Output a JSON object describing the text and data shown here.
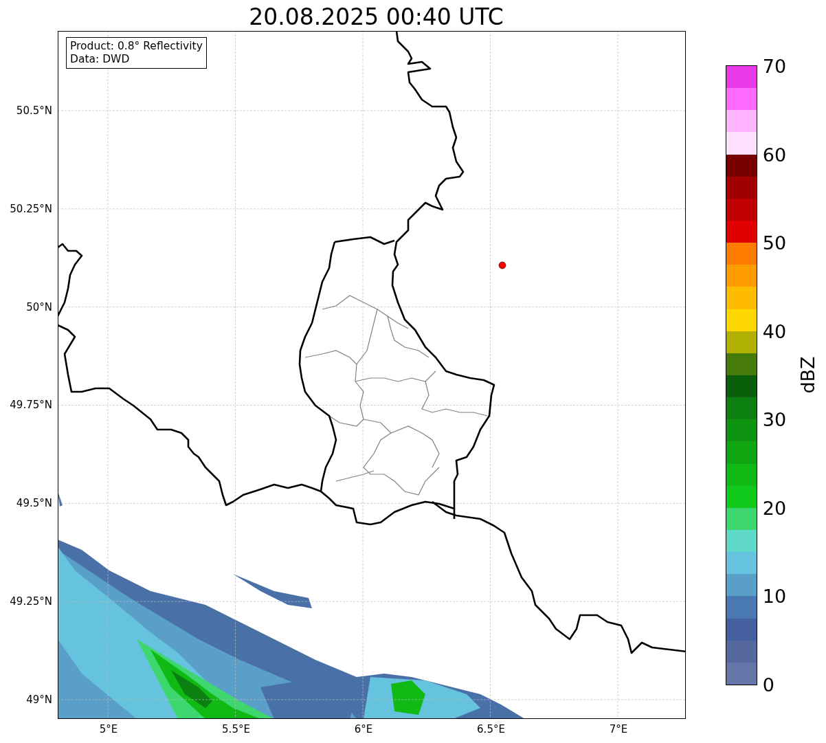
{
  "title": "20.08.2025 00:40 UTC",
  "info_box": [
    "Product: 0.8° Reflectivity",
    "Data: DWD"
  ],
  "lat_ticks": [
    "50.5°N",
    "50.25°N",
    "50°N",
    "49.75°N",
    "49.5°N",
    "49.25°N",
    "49°N"
  ],
  "lon_ticks": [
    "5°E",
    "5.5°E",
    "6°E",
    "6.5°E",
    "7°E"
  ],
  "colorbar": {
    "label": "dBZ",
    "ticks": [
      "70",
      "60",
      "50",
      "40",
      "30",
      "20",
      "10",
      "0"
    ],
    "segments": [
      {
        "color": "#e83ae8"
      },
      {
        "color": "#ff6cff"
      },
      {
        "color": "#ffb4ff"
      },
      {
        "color": "#ffe0ff"
      },
      {
        "color": "#7a0000"
      },
      {
        "color": "#a00000"
      },
      {
        "color": "#c00000"
      },
      {
        "color": "#e00000"
      },
      {
        "color": "#ff7c00"
      },
      {
        "color": "#ff9c00"
      },
      {
        "color": "#ffbb00"
      },
      {
        "color": "#ffd700"
      },
      {
        "color": "#b0b003"
      },
      {
        "color": "#467a0a"
      },
      {
        "color": "#0a5f0a"
      },
      {
        "color": "#0b7f0f"
      },
      {
        "color": "#0e9410"
      },
      {
        "color": "#0fa612"
      },
      {
        "color": "#10b914"
      },
      {
        "color": "#11c91b"
      },
      {
        "color": "#3dd66f"
      },
      {
        "color": "#5fd8c8"
      },
      {
        "color": "#65c3de"
      },
      {
        "color": "#5a9fc8"
      },
      {
        "color": "#4a78b0"
      },
      {
        "color": "#4560a0"
      },
      {
        "color": "#56699f"
      },
      {
        "color": "#6675a8"
      }
    ]
  }
}
